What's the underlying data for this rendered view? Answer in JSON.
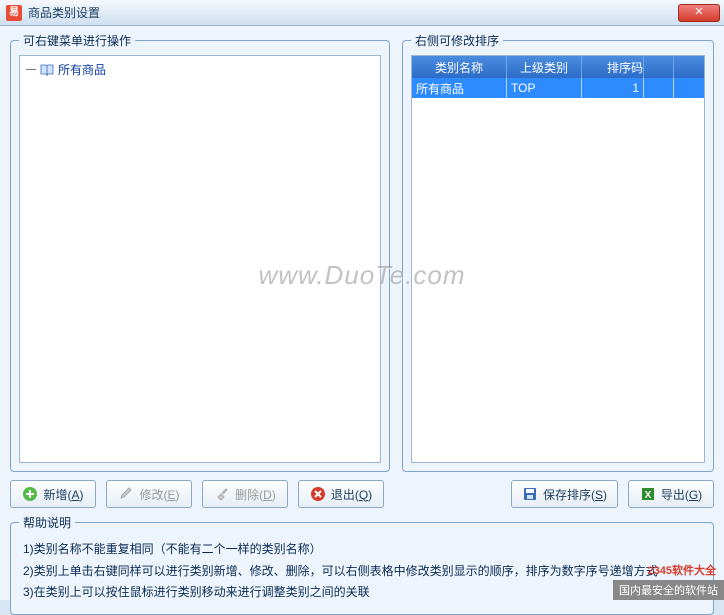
{
  "window": {
    "title": "商品类别设置",
    "app_icon_glyph": "易",
    "close_glyph": "✕"
  },
  "left": {
    "legend": "可右键菜单进行操作",
    "tree": {
      "expand_glyph": "—",
      "root_label": "所有商品"
    }
  },
  "right": {
    "legend": "右侧可修改排序",
    "headers": [
      "类别名称",
      "上级类别",
      "排序码",
      ""
    ],
    "rows": [
      {
        "name": "所有商品",
        "parent": "TOP",
        "order": "1"
      }
    ]
  },
  "toolbar": {
    "add": {
      "label": "新增",
      "key": "A"
    },
    "edit": {
      "label": "修改",
      "key": "E"
    },
    "delete": {
      "label": "删除",
      "key": "D"
    },
    "quit": {
      "label": "退出",
      "key": "Q"
    },
    "save": {
      "label": "保存排序",
      "key": "S"
    },
    "export": {
      "label": "导出",
      "key": "G"
    }
  },
  "help": {
    "legend": "帮助说明",
    "lines": [
      "1)类别名称不能重复相同（不能有二个一样的类别名称）",
      "2)类别上单击右键同样可以进行类别新增、修改、删除，可以右侧表格中修改类别显示的顺序，排序为数字序号递增方式",
      "3)在类别上可以按住鼠标进行类别移动来进行调整类别之间的关联"
    ]
  },
  "overlay": {
    "watermark": "www.DuoTe.com",
    "corner_logo": "2345软件大全",
    "footer": "国内最安全的软件站"
  }
}
